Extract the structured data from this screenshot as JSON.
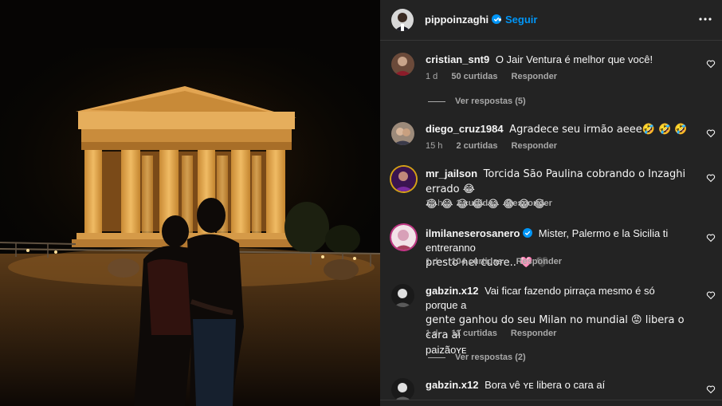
{
  "post": {
    "author": "pippoinzaghi",
    "follow_label": "Seguir",
    "dot": "•"
  },
  "icons": {
    "verified": "verified-badge-icon",
    "more": "more-options-icon",
    "heart": "heart-icon"
  },
  "colors": {
    "panel_bg": "#232323",
    "accent": "#0095f6",
    "muted": "#a8a8a8"
  },
  "comments": [
    {
      "user": "cristian_snt9",
      "text": "O Jair Ventura é melhor que você!",
      "time": "1 d",
      "likes": "50 curtidas",
      "reply": "Responder",
      "view_replies": "Ver respostas (5)"
    },
    {
      "user": "diego_cruz1984",
      "text": "Agradece seu irmão aeee🤣 🤣 🤣",
      "time": "15 h",
      "likes": "2 curtidas",
      "reply": "Responder"
    },
    {
      "user": "mr_jailson",
      "text": "Torcida São Paulina cobrando o Inzaghi errado 😂",
      "text2": "😂 😂 😂 😂 😂 😂 😂 😂",
      "time": "15 h",
      "likes": "1 curtida",
      "reply": "Responder"
    },
    {
      "user": "ilmilaneserosanero",
      "text": "Mister, Palermo e la Sicilia ti entreranno",
      "text2": "presto nel cuore.. 🩷 🖤",
      "time": "1 d",
      "likes": "104 curtidas",
      "reply": "Responder"
    },
    {
      "user": "gabzin.x12",
      "text": "Vai ficar fazendo pirraça mesmo é só porque a",
      "text2": "gente ganhou do seu Milan no mundial 😡 libera o cara aí",
      "text3": "paizãoʏᴇ",
      "time": "1 d",
      "likes": "11 curtidas",
      "reply": "Responder",
      "view_replies": "Ver respostas (2)"
    },
    {
      "user": "gabzin.x12",
      "text": "Bora vê ʏᴇ libera o cara aí"
    }
  ]
}
